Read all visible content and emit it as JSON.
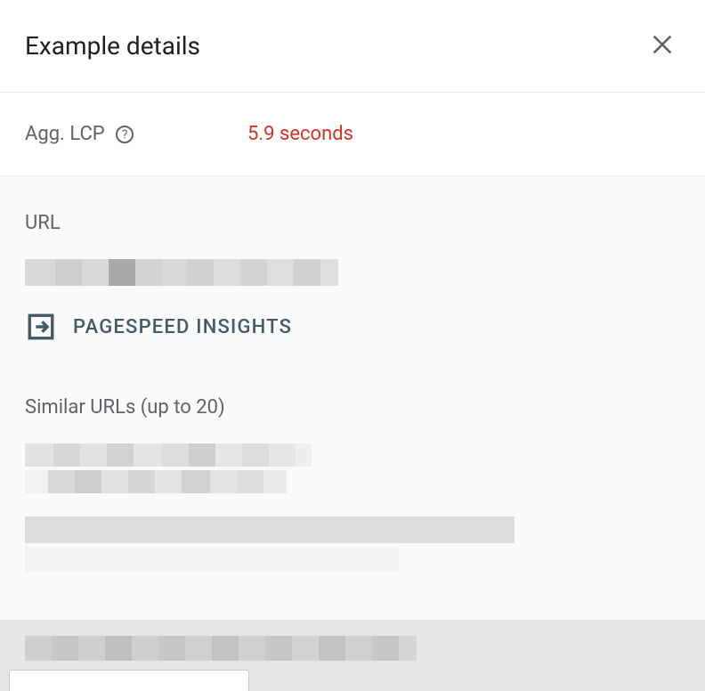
{
  "header": {
    "title": "Example details"
  },
  "metric": {
    "label": "Agg. LCP",
    "value": "5.9 seconds",
    "value_color": "#d93025"
  },
  "url_section": {
    "label": "URL",
    "pagespeed_link_label": "PAGESPEED INSIGHTS"
  },
  "similar_section": {
    "label": "Similar URLs (up to 20)"
  },
  "icons": {
    "close": "close-icon",
    "help": "help-icon",
    "external": "open-external-icon"
  }
}
